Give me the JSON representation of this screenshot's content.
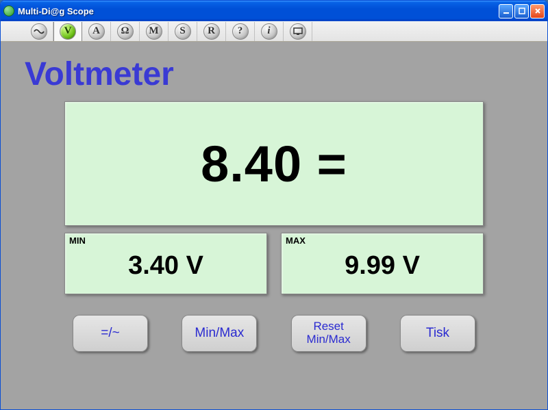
{
  "window": {
    "title": "Multi-Di@g Scope"
  },
  "toolbar": {
    "items": [
      {
        "name": "wave-icon",
        "glyph": "~"
      },
      {
        "name": "voltmeter-icon",
        "glyph": "V"
      },
      {
        "name": "ammeter-icon",
        "glyph": "A"
      },
      {
        "name": "ohmmeter-icon",
        "glyph": "Ω"
      },
      {
        "name": "m-icon",
        "glyph": "M"
      },
      {
        "name": "s-icon",
        "glyph": "S"
      },
      {
        "name": "r-icon",
        "glyph": "R"
      },
      {
        "name": "help-icon",
        "glyph": "?"
      },
      {
        "name": "info-icon",
        "glyph": "i"
      },
      {
        "name": "screen-icon",
        "glyph": "⎚"
      }
    ],
    "selected_index": 1
  },
  "page": {
    "title": "Voltmeter"
  },
  "display": {
    "value": "8.40 ="
  },
  "min": {
    "label": "MIN",
    "value": "3.40 V"
  },
  "max": {
    "label": "MAX",
    "value": "9.99 V"
  },
  "buttons": {
    "mode": "=/~",
    "minmax": "Min/Max",
    "reset": "Reset\nMin/Max",
    "print": "Tisk"
  }
}
